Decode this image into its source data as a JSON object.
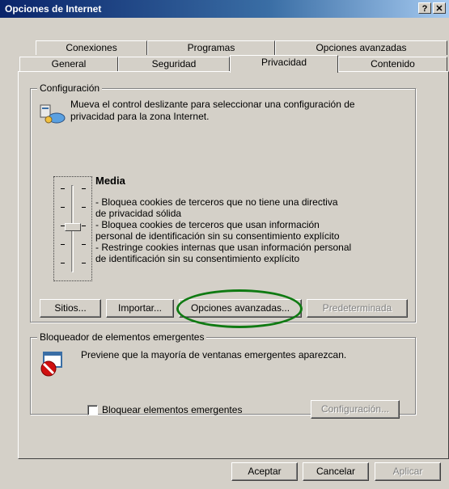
{
  "window": {
    "title": "Opciones de Internet",
    "help_label": "?",
    "close_label": "✕"
  },
  "tabs_row1": [
    "Conexiones",
    "Programas",
    "Opciones avanzadas"
  ],
  "tabs_row2": [
    "General",
    "Seguridad",
    "Privacidad",
    "Contenido"
  ],
  "active_tab": "Privacidad",
  "config": {
    "legend": "Configuración",
    "description_line1": "Mueva el control deslizante para seleccionar una configuración de",
    "description_line2": "privacidad para la zona Internet.",
    "level_title": "Media",
    "level_lines": [
      "- Bloquea cookies de terceros que no tiene una directiva",
      "de privacidad sólida",
      "- Bloquea cookies de terceros que usan información",
      "personal de identificación sin su consentimiento explícito",
      "- Restringe cookies internas que usan información personal",
      "de identificación sin su consentimiento explícito"
    ],
    "buttons": {
      "sites_label": "Sitios...",
      "import_label": "Importar...",
      "advanced_label": "Opciones avanzadas...",
      "default_label": "Predeterminada"
    }
  },
  "popup": {
    "legend": "Bloqueador de elementos emergentes",
    "description": "Previene que la mayoría de ventanas emergentes aparezcan.",
    "checkbox_label": "Bloquear elementos emergentes",
    "checkbox_checked": false,
    "settings_label": "Configuración..."
  },
  "footer": {
    "ok_label": "Aceptar",
    "cancel_label": "Cancelar",
    "apply_label": "Aplicar"
  },
  "colors": {
    "face": "#d4d0c8",
    "highlight_ring": "#0f7a12",
    "title_bar": "#0a246a"
  },
  "slider_level": "Media"
}
